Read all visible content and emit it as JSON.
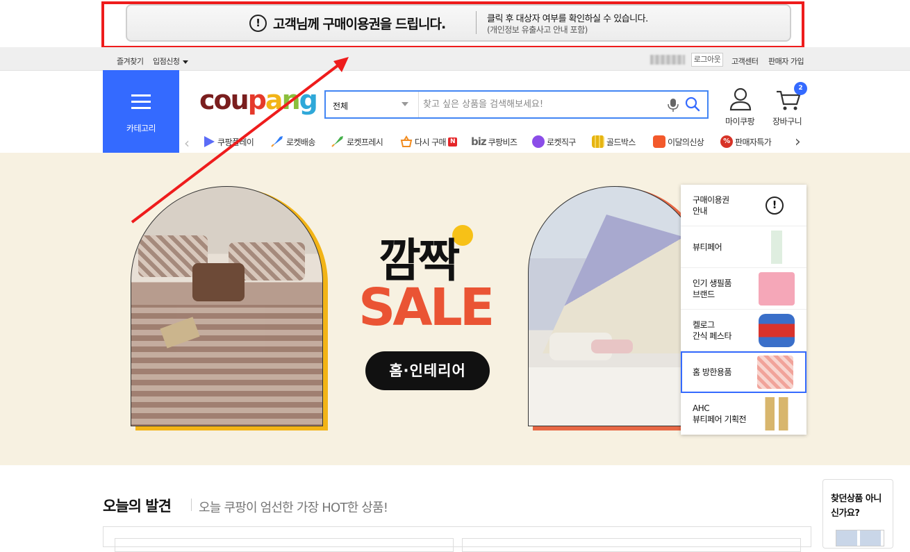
{
  "notice": {
    "icon": "!",
    "title": "고객님께 구매이용권을 드립니다.",
    "description": "클릭 후 대상자 여부를 확인하실 수 있습니다.",
    "sub_description": "(개인정보 유출사고 안내 포함)"
  },
  "util_bar": {
    "bookmark": "즐겨찾기",
    "seller_apply": "입점신청",
    "logout": "로그아웃",
    "customer_center": "고객센터",
    "seller_signup": "판매자 가입"
  },
  "header": {
    "category_label": "카테고리",
    "logo": [
      "c",
      "o",
      "u",
      "p",
      "a",
      "n",
      "g"
    ],
    "search": {
      "category": "전체",
      "placeholder": "찾고 싶은 상품을 검색해보세요!"
    },
    "mycoupang_label": "마이쿠팡",
    "cart_label": "장바구니",
    "cart_count": "2"
  },
  "nav": {
    "items": [
      {
        "label": "쿠팡플레이",
        "color": "#5b6cf7"
      },
      {
        "label": "로켓배송",
        "color": "#2f7cf6"
      },
      {
        "label": "로켓프레시",
        "color": "#45b04b"
      },
      {
        "label": "다시 구매",
        "color": "#f18b1f",
        "badge": "N"
      },
      {
        "label": "쿠팡비즈",
        "prefix": "biz",
        "color": "#666666"
      },
      {
        "label": "로켓직구",
        "color": "#8b4de8"
      },
      {
        "label": "골드박스",
        "color": "#e6b410"
      },
      {
        "label": "이달의신상",
        "color": "#f3592b"
      },
      {
        "label": "판매자특가",
        "color": "#d73327"
      }
    ]
  },
  "banner": {
    "headline_top": "깜짝",
    "headline_main": "SALE",
    "pill": "홈·인테리어",
    "colors": {
      "background": "#f7f1e1",
      "sale": "#ea5434",
      "accent_yellow": "#f2b417"
    }
  },
  "side_panel": {
    "items": [
      {
        "label_line1": "구매이용권",
        "label_line2": "안내",
        "thumb": "alert-icon"
      },
      {
        "label_line1": "뷰티페어",
        "label_line2": "",
        "thumb": "serum-bottle"
      },
      {
        "label_line1": "인기 생필품",
        "label_line2": "브랜드",
        "thumb": "pink-pack"
      },
      {
        "label_line1": "켈로그",
        "label_line2": "간식 페스타",
        "thumb": "snack-cup"
      },
      {
        "label_line1": "홈 방한용품",
        "label_line2": "",
        "thumb": "warmer-pack"
      },
      {
        "label_line1": "AHC",
        "label_line2": "뷰티페어 기획전",
        "thumb": "gold-bottles"
      }
    ]
  },
  "today": {
    "title": "오늘의 발견",
    "subtitle": "오늘 쿠팡이 엄선한 가장 HOT한 상품!"
  },
  "find_product": {
    "label": "찾던상품 아니신가요?"
  }
}
